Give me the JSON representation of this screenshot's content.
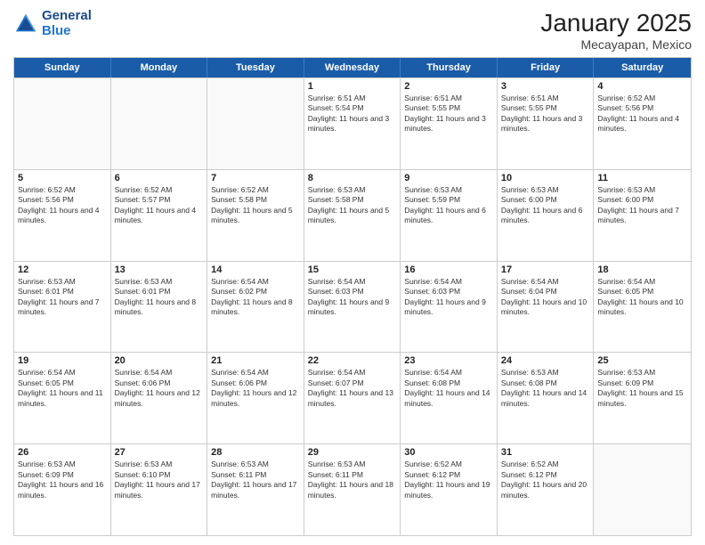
{
  "logo": {
    "line1": "General",
    "line2": "Blue"
  },
  "title": "January 2025",
  "subtitle": "Mecayapan, Mexico",
  "days_of_week": [
    "Sunday",
    "Monday",
    "Tuesday",
    "Wednesday",
    "Thursday",
    "Friday",
    "Saturday"
  ],
  "weeks": [
    [
      {
        "day": "",
        "sunrise": "",
        "sunset": "",
        "daylight": ""
      },
      {
        "day": "",
        "sunrise": "",
        "sunset": "",
        "daylight": ""
      },
      {
        "day": "",
        "sunrise": "",
        "sunset": "",
        "daylight": ""
      },
      {
        "day": "1",
        "sunrise": "Sunrise: 6:51 AM",
        "sunset": "Sunset: 5:54 PM",
        "daylight": "Daylight: 11 hours and 3 minutes."
      },
      {
        "day": "2",
        "sunrise": "Sunrise: 6:51 AM",
        "sunset": "Sunset: 5:55 PM",
        "daylight": "Daylight: 11 hours and 3 minutes."
      },
      {
        "day": "3",
        "sunrise": "Sunrise: 6:51 AM",
        "sunset": "Sunset: 5:55 PM",
        "daylight": "Daylight: 11 hours and 3 minutes."
      },
      {
        "day": "4",
        "sunrise": "Sunrise: 6:52 AM",
        "sunset": "Sunset: 5:56 PM",
        "daylight": "Daylight: 11 hours and 4 minutes."
      }
    ],
    [
      {
        "day": "5",
        "sunrise": "Sunrise: 6:52 AM",
        "sunset": "Sunset: 5:56 PM",
        "daylight": "Daylight: 11 hours and 4 minutes."
      },
      {
        "day": "6",
        "sunrise": "Sunrise: 6:52 AM",
        "sunset": "Sunset: 5:57 PM",
        "daylight": "Daylight: 11 hours and 4 minutes."
      },
      {
        "day": "7",
        "sunrise": "Sunrise: 6:52 AM",
        "sunset": "Sunset: 5:58 PM",
        "daylight": "Daylight: 11 hours and 5 minutes."
      },
      {
        "day": "8",
        "sunrise": "Sunrise: 6:53 AM",
        "sunset": "Sunset: 5:58 PM",
        "daylight": "Daylight: 11 hours and 5 minutes."
      },
      {
        "day": "9",
        "sunrise": "Sunrise: 6:53 AM",
        "sunset": "Sunset: 5:59 PM",
        "daylight": "Daylight: 11 hours and 6 minutes."
      },
      {
        "day": "10",
        "sunrise": "Sunrise: 6:53 AM",
        "sunset": "Sunset: 6:00 PM",
        "daylight": "Daylight: 11 hours and 6 minutes."
      },
      {
        "day": "11",
        "sunrise": "Sunrise: 6:53 AM",
        "sunset": "Sunset: 6:00 PM",
        "daylight": "Daylight: 11 hours and 7 minutes."
      }
    ],
    [
      {
        "day": "12",
        "sunrise": "Sunrise: 6:53 AM",
        "sunset": "Sunset: 6:01 PM",
        "daylight": "Daylight: 11 hours and 7 minutes."
      },
      {
        "day": "13",
        "sunrise": "Sunrise: 6:53 AM",
        "sunset": "Sunset: 6:01 PM",
        "daylight": "Daylight: 11 hours and 8 minutes."
      },
      {
        "day": "14",
        "sunrise": "Sunrise: 6:54 AM",
        "sunset": "Sunset: 6:02 PM",
        "daylight": "Daylight: 11 hours and 8 minutes."
      },
      {
        "day": "15",
        "sunrise": "Sunrise: 6:54 AM",
        "sunset": "Sunset: 6:03 PM",
        "daylight": "Daylight: 11 hours and 9 minutes."
      },
      {
        "day": "16",
        "sunrise": "Sunrise: 6:54 AM",
        "sunset": "Sunset: 6:03 PM",
        "daylight": "Daylight: 11 hours and 9 minutes."
      },
      {
        "day": "17",
        "sunrise": "Sunrise: 6:54 AM",
        "sunset": "Sunset: 6:04 PM",
        "daylight": "Daylight: 11 hours and 10 minutes."
      },
      {
        "day": "18",
        "sunrise": "Sunrise: 6:54 AM",
        "sunset": "Sunset: 6:05 PM",
        "daylight": "Daylight: 11 hours and 10 minutes."
      }
    ],
    [
      {
        "day": "19",
        "sunrise": "Sunrise: 6:54 AM",
        "sunset": "Sunset: 6:05 PM",
        "daylight": "Daylight: 11 hours and 11 minutes."
      },
      {
        "day": "20",
        "sunrise": "Sunrise: 6:54 AM",
        "sunset": "Sunset: 6:06 PM",
        "daylight": "Daylight: 11 hours and 12 minutes."
      },
      {
        "day": "21",
        "sunrise": "Sunrise: 6:54 AM",
        "sunset": "Sunset: 6:06 PM",
        "daylight": "Daylight: 11 hours and 12 minutes."
      },
      {
        "day": "22",
        "sunrise": "Sunrise: 6:54 AM",
        "sunset": "Sunset: 6:07 PM",
        "daylight": "Daylight: 11 hours and 13 minutes."
      },
      {
        "day": "23",
        "sunrise": "Sunrise: 6:54 AM",
        "sunset": "Sunset: 6:08 PM",
        "daylight": "Daylight: 11 hours and 14 minutes."
      },
      {
        "day": "24",
        "sunrise": "Sunrise: 6:53 AM",
        "sunset": "Sunset: 6:08 PM",
        "daylight": "Daylight: 11 hours and 14 minutes."
      },
      {
        "day": "25",
        "sunrise": "Sunrise: 6:53 AM",
        "sunset": "Sunset: 6:09 PM",
        "daylight": "Daylight: 11 hours and 15 minutes."
      }
    ],
    [
      {
        "day": "26",
        "sunrise": "Sunrise: 6:53 AM",
        "sunset": "Sunset: 6:09 PM",
        "daylight": "Daylight: 11 hours and 16 minutes."
      },
      {
        "day": "27",
        "sunrise": "Sunrise: 6:53 AM",
        "sunset": "Sunset: 6:10 PM",
        "daylight": "Daylight: 11 hours and 17 minutes."
      },
      {
        "day": "28",
        "sunrise": "Sunrise: 6:53 AM",
        "sunset": "Sunset: 6:11 PM",
        "daylight": "Daylight: 11 hours and 17 minutes."
      },
      {
        "day": "29",
        "sunrise": "Sunrise: 6:53 AM",
        "sunset": "Sunset: 6:11 PM",
        "daylight": "Daylight: 11 hours and 18 minutes."
      },
      {
        "day": "30",
        "sunrise": "Sunrise: 6:52 AM",
        "sunset": "Sunset: 6:12 PM",
        "daylight": "Daylight: 11 hours and 19 minutes."
      },
      {
        "day": "31",
        "sunrise": "Sunrise: 6:52 AM",
        "sunset": "Sunset: 6:12 PM",
        "daylight": "Daylight: 11 hours and 20 minutes."
      },
      {
        "day": "",
        "sunrise": "",
        "sunset": "",
        "daylight": ""
      }
    ]
  ]
}
